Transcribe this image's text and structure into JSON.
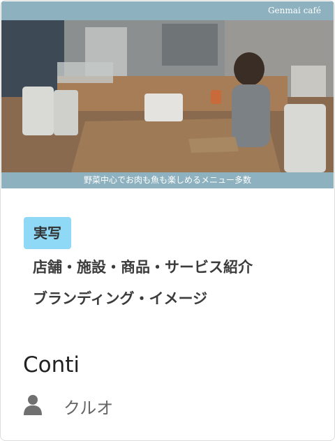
{
  "thumbnail": {
    "brand": "Genmai café",
    "caption": "野菜中心でお肉も魚も楽しめるメニュー多数"
  },
  "tag": "実写",
  "categories": [
    "店舗・施設・商品・サービス紹介",
    "ブランディング・イメージ"
  ],
  "title": "Conti",
  "author": {
    "icon": "user-icon",
    "name": "クルオ"
  },
  "colors": {
    "tag_bg": "#8fd8f6",
    "thumb_bar": "#8db1bf"
  }
}
